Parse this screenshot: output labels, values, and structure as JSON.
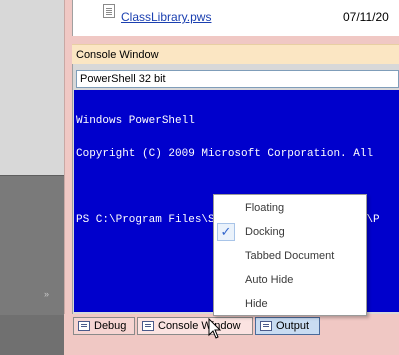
{
  "file_list": {
    "file_name": "ClassLibrary.pws",
    "file_date": "07/11/20"
  },
  "console": {
    "title": "Console Window",
    "shell_selected": "PowerShell 32 bit",
    "terminal_lines": [
      "Windows PowerShell",
      "Copyright (C) 2009 Microsoft Corporation. All",
      "",
      "PS C:\\Program Files\\SAPIEN Technologies, Inc\\P"
    ]
  },
  "context_menu": {
    "items": [
      {
        "label": "Floating",
        "checked": false
      },
      {
        "label": "Docking",
        "checked": true
      },
      {
        "label": "Tabbed Document",
        "checked": false
      },
      {
        "label": "Auto Hide",
        "checked": false
      },
      {
        "label": "Hide",
        "checked": false
      }
    ],
    "check_glyph": "✓"
  },
  "tabs": {
    "debug": "Debug",
    "console": "Console Window",
    "output": "Output"
  },
  "left_panel": {
    "chevron": "»"
  },
  "colors": {
    "terminal_bg": "#0000cc",
    "frame_pink": "#f0c8c4",
    "title_bar": "#fbe6c3",
    "link_blue": "#1a3fb0"
  },
  "icons": [
    "document-icon",
    "checkmark-icon",
    "debug-tab-icon",
    "console-tab-icon",
    "output-tab-icon",
    "mouse-cursor-icon",
    "chevron-double-down-icon"
  ]
}
